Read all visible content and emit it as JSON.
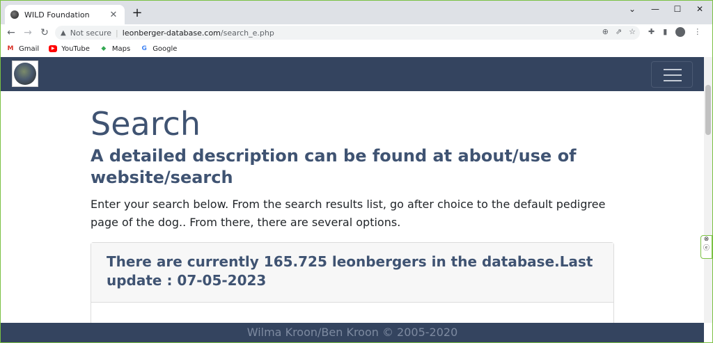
{
  "browser": {
    "tab_title": "WILD Foundation",
    "tab_close": "✕",
    "new_tab": "+",
    "window_controls": [
      "⌄",
      "—",
      "☐",
      "✕"
    ],
    "nav": {
      "back": "←",
      "forward": "→",
      "reload": "↻"
    },
    "security_warning": "▲",
    "not_secure": "Not secure",
    "url_host": "leonberger-database.com",
    "url_path": "/search_e.php",
    "omnibox_icons": [
      "zoom-icon",
      "share-icon",
      "bookmark-star-icon"
    ],
    "extension_icons": [
      "extensions-icon",
      "side-panel-icon",
      "profile-icon",
      "menu-icon"
    ]
  },
  "bookmarks": [
    {
      "label": "Gmail",
      "icon": "gmail-icon",
      "glyph": "M"
    },
    {
      "label": "YouTube",
      "icon": "youtube-icon",
      "glyph": "▶"
    },
    {
      "label": "Maps",
      "icon": "maps-icon",
      "glyph": "◆"
    },
    {
      "label": "Google",
      "icon": "google-icon",
      "glyph": "G"
    }
  ],
  "page": {
    "title": "Search",
    "subtitle": "A detailed description can be found at about/use of website/search",
    "intro": "Enter your search below. From the search results list, go after choice to the default pedigree page of the dog.. From there, there are several options.",
    "stats_prefix": "There are currently",
    "stats_count": "165.725",
    "stats_suffix": "leonbergers in the database.Last update : 07-05-2023"
  },
  "footer": {
    "text": "Wilma Kroon/Ben Kroon © 2005-2020"
  },
  "colors": {
    "header_bg": "#34445f",
    "heading": "#3f5372",
    "border_accent": "#7ac143"
  }
}
